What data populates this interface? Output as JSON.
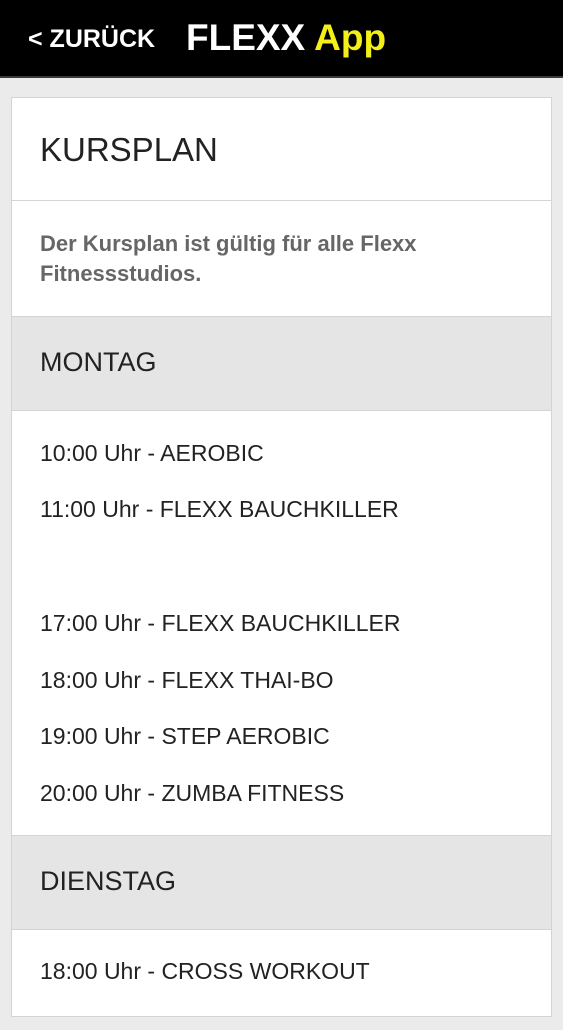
{
  "topbar": {
    "back_label": "< ZURÜCK",
    "brand": "FLEXX",
    "brand_suffix": "App"
  },
  "content": {
    "title": "KURSPLAN",
    "note": "Der Kursplan ist gültig für alle Flexx Fitnessstudios."
  },
  "days": [
    {
      "name": "MONTAG",
      "classes": [
        "10:00 Uhr - AEROBIC",
        "11:00 Uhr - FLEXX BAUCHKILLER",
        "17:00 Uhr - FLEXX BAUCHKILLER",
        "18:00 Uhr - FLEXX THAI-BO",
        "19:00 Uhr - STEP AEROBIC",
        "20:00 Uhr - ZUMBA FITNESS"
      ]
    },
    {
      "name": "DIENSTAG",
      "classes": [
        "18:00 Uhr - CROSS WORKOUT"
      ]
    }
  ],
  "colors": {
    "topbar_bg": "#000000",
    "brand_text": "#ffffff",
    "brand_suffix_text": "#f3ef17",
    "day_header_bg": "#e5e5e5",
    "page_bg": "#ebebeb"
  }
}
